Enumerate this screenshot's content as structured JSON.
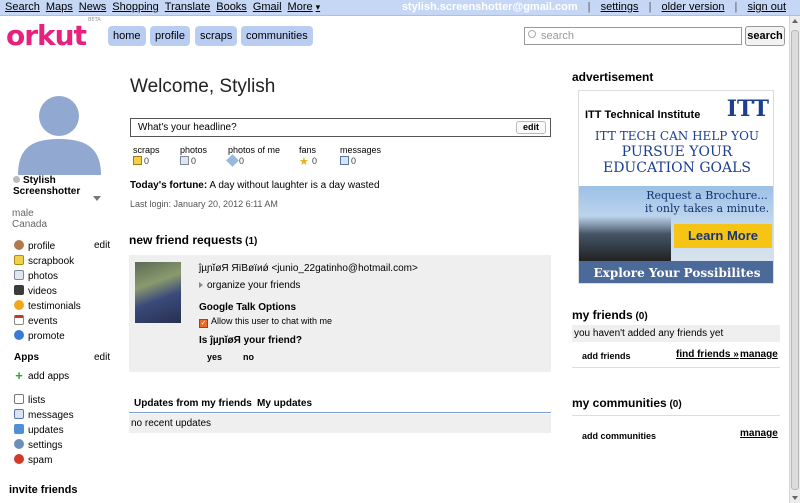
{
  "gbar": {
    "links": [
      "Search",
      "Maps",
      "News",
      "Shopping",
      "Translate",
      "Books",
      "Gmail",
      "More"
    ],
    "more_arrow": "▾",
    "email": "stylish.screenshotter@gmail.com",
    "settings": "settings",
    "older_version": "older version",
    "sign_out": "sign out",
    "sep": "|"
  },
  "header": {
    "logo": "orkut",
    "logo_tag": "BETA",
    "nav": [
      "home",
      "profile",
      "scraps",
      "communities"
    ],
    "search_placeholder": "search",
    "search_button": "search"
  },
  "profile": {
    "name_line1": "Stylish",
    "name_line2": "Screenshotter",
    "sex": "male",
    "country": "Canada"
  },
  "left_nav": {
    "items": [
      {
        "label": "profile",
        "icon": "profile-icon"
      },
      {
        "label": "scrapbook",
        "icon": "scrapbook-icon"
      },
      {
        "label": "photos",
        "icon": "photos-icon"
      },
      {
        "label": "videos",
        "icon": "videos-icon"
      },
      {
        "label": "testimonials",
        "icon": "testimonials-icon"
      },
      {
        "label": "events",
        "icon": "events-icon"
      },
      {
        "label": "promote",
        "icon": "promote-icon"
      }
    ],
    "edit": "edit",
    "apps_heading": "Apps",
    "apps_edit": "edit",
    "add_apps": "add apps",
    "tools": [
      {
        "label": "lists",
        "icon": "lists-icon"
      },
      {
        "label": "messages",
        "icon": "messages-icon"
      },
      {
        "label": "updates",
        "icon": "updates-icon"
      },
      {
        "label": "settings",
        "icon": "settings-icon"
      },
      {
        "label": "spam",
        "icon": "spam-icon"
      }
    ],
    "invite_heading": "invite friends"
  },
  "main": {
    "welcome": "Welcome, Stylish",
    "headline_placeholder": "What's your headline?",
    "headline_edit": "edit",
    "stats": [
      {
        "label": "scraps",
        "count": "0",
        "icon": "scrap-icon"
      },
      {
        "label": "photos",
        "count": "0",
        "icon": "photo-icon"
      },
      {
        "label": "photos of me",
        "count": "0",
        "icon": "tag-icon"
      },
      {
        "label": "fans",
        "count": "0",
        "icon": "star-icon"
      },
      {
        "label": "messages",
        "count": "0",
        "icon": "envelope-icon"
      }
    ],
    "fortune_label": "Today's fortune:",
    "fortune_text": " A day without laughter is a day wasted",
    "last_login": "Last login: January 20, 2012 6:11 AM",
    "friend_requests_title": "new friend requests",
    "friend_requests_count": " (1)",
    "request": {
      "name": "ĵµɲĭøЯ ЯïВøïиǿ <junio_22gatinho@hotmail.com>",
      "organize": "organize your friends",
      "gtalk_heading": "Google Talk Options",
      "allow_chat": "Allow this user to chat with me",
      "question": "Is ĵµɲĭøЯ your friend?",
      "yes": "yes",
      "no": "no"
    },
    "updates_tabs": [
      "Updates from my friends",
      "My updates"
    ],
    "no_updates": "no recent updates"
  },
  "right": {
    "ad_heading": "advertisement",
    "ad": {
      "brand": "ITT Technical Institute",
      "logo": "ITT",
      "headline_1": "ITT TECH CAN HELP YOU",
      "headline_2": "PURSUE YOUR",
      "headline_3": "EDUCATION GOALS",
      "request_1": "Request a Brochure...",
      "request_2": "it only takes a minute.",
      "cta": "Learn More",
      "footer": "Explore Your Possibilites"
    },
    "friends_title": "my friends",
    "friends_count": " (0)",
    "friends_empty": "you haven't added any friends yet",
    "add_friends": "add friends",
    "find_friends": "find friends »",
    "friends_manage": "manage",
    "communities_title": "my communities",
    "communities_count": " (0)",
    "add_communities": "add communities",
    "communities_manage": "manage"
  }
}
